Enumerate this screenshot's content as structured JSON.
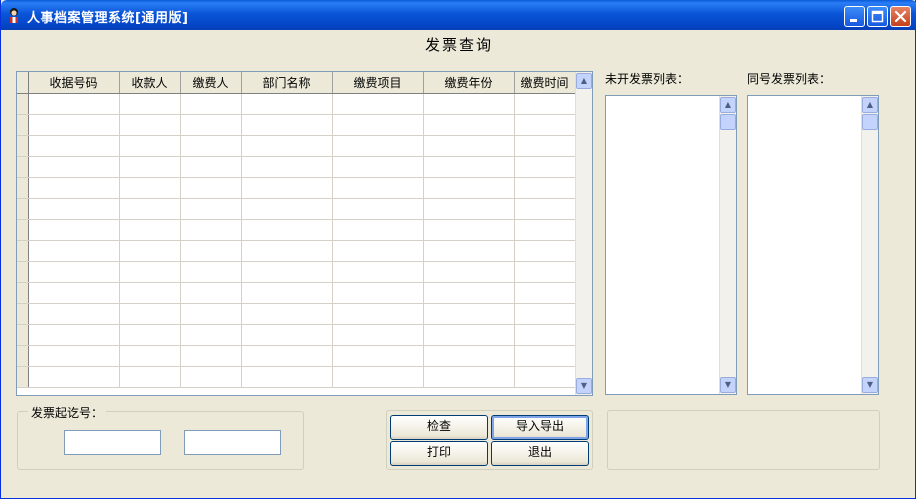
{
  "window": {
    "title": "人事档案管理系统[通用版]"
  },
  "page": {
    "heading": "发票查询"
  },
  "grid": {
    "columns": [
      "收据号码",
      "收款人",
      "缴费人",
      "部门名称",
      "缴费项目",
      "缴费年份",
      "缴费时间"
    ],
    "empty_rows": 14
  },
  "lists": {
    "unissued_label": "未开发票列表：",
    "same_number_label": "同号发票列表："
  },
  "invoice_range": {
    "label": "发票起讫号：",
    "start_value": "",
    "end_value": ""
  },
  "buttons": {
    "check": "检查",
    "import_export": "导入导出",
    "print": "打印",
    "exit": "退出"
  },
  "icons": {
    "app": "person-icon",
    "minimize": "minimize-icon",
    "maximize": "maximize-icon",
    "close": "close-icon",
    "scroll_up": "scroll-up-arrow-icon",
    "scroll_down": "scroll-down-arrow-icon"
  }
}
